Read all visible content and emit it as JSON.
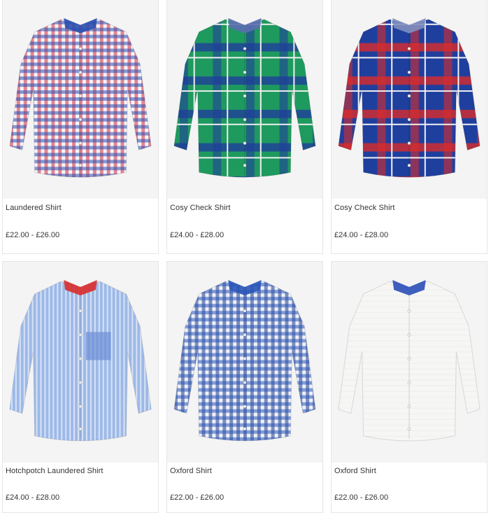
{
  "products": [
    {
      "name": "Laundered Shirt",
      "price": "£22.00 - £26.00",
      "image": "red-blue-gingham-shirt",
      "colors": {
        "base": "#f5f5f8",
        "a": "#d8283a",
        "b": "#2a4fb0",
        "collar": "#2a4fb0"
      }
    },
    {
      "name": "Cosy Check Shirt",
      "price": "£24.00 - £28.00",
      "image": "green-blue-check-shirt",
      "colors": {
        "base": "#1e9a5e",
        "a": "#1f3f9a",
        "b": "#f0f0f0",
        "collar": "#5a6fb0"
      }
    },
    {
      "name": "Cosy Check Shirt",
      "price": "£24.00 - £28.00",
      "image": "blue-red-check-shirt",
      "colors": {
        "base": "#1f3f9e",
        "a": "#d92b2b",
        "b": "#f2f2f2",
        "collar": "#7f8fbf"
      }
    },
    {
      "name": "Hotchpotch Laundered Shirt",
      "price": "£24.00 - £28.00",
      "image": "light-blue-patchwork-shirt",
      "colors": {
        "base": "#9db9e8",
        "a": "#6d8fd6",
        "b": "#f2f5fb",
        "collar": "#d92b2b"
      }
    },
    {
      "name": "Oxford Shirt",
      "price": "£22.00 - £26.00",
      "image": "navy-gingham-shirt",
      "colors": {
        "base": "#eef1f8",
        "a": "#1e3c8c",
        "b": "#2b56b8",
        "collar": "#2b56b8"
      }
    },
    {
      "name": "Oxford Shirt",
      "price": "£22.00 - £26.00",
      "image": "white-oxford-shirt",
      "colors": {
        "base": "#f6f6f4",
        "a": "#e8e8e4",
        "b": "#ffffff",
        "collar": "#2b4fb8"
      }
    }
  ]
}
